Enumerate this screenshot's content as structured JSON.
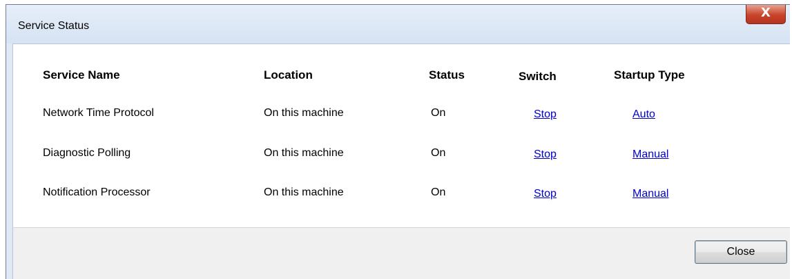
{
  "window": {
    "title": "Service Status",
    "close_glyph": "X"
  },
  "table": {
    "headers": {
      "service_name": "Service Name",
      "location": "Location",
      "status": "Status",
      "switch": "Switch",
      "startup_type": "Startup Type"
    },
    "rows": [
      {
        "service_name": "Network Time Protocol",
        "location": "On this machine",
        "status": "On",
        "switch": "Stop",
        "startup_type": "Auto"
      },
      {
        "service_name": "Diagnostic Polling",
        "location": "On this machine",
        "status": "On",
        "switch": "Stop",
        "startup_type": "Manual"
      },
      {
        "service_name": "Notification Processor",
        "location": "On this machine",
        "status": "On",
        "switch": "Stop",
        "startup_type": "Manual"
      }
    ]
  },
  "footer": {
    "close_label": "Close"
  },
  "colors": {
    "link": "#0000cc",
    "close_button_red": "#c9432a"
  }
}
